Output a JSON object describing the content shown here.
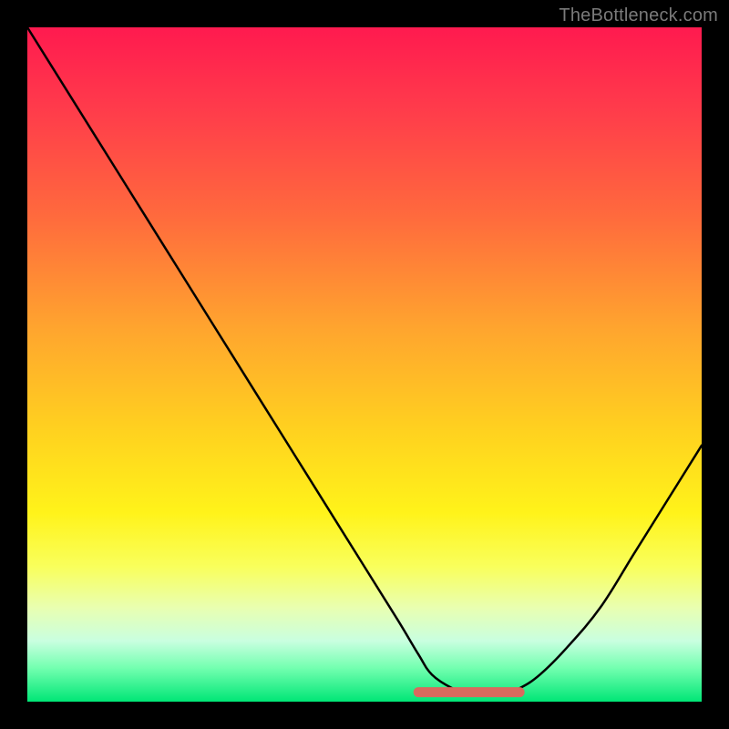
{
  "watermark": "TheBottleneck.com",
  "chart_data": {
    "type": "line",
    "title": "",
    "xlabel": "",
    "ylabel": "",
    "xlim": [
      0,
      100
    ],
    "ylim": [
      0,
      100
    ],
    "grid": false,
    "legend": false,
    "series": [
      {
        "name": "main-curve",
        "color": "#000000",
        "x": [
          0,
          5,
          10,
          15,
          20,
          25,
          30,
          35,
          40,
          45,
          50,
          55,
          58,
          60,
          63,
          66,
          70,
          73,
          76,
          80,
          85,
          90,
          95,
          100
        ],
        "y": [
          100,
          92,
          84,
          76,
          68,
          60,
          52,
          44,
          36,
          28,
          20,
          12,
          7,
          4,
          2,
          1,
          1,
          2,
          4,
          8,
          14,
          22,
          30,
          38
        ]
      },
      {
        "name": "marker-band",
        "color": "#d96a5e",
        "x": [
          58,
          73
        ],
        "y": [
          1,
          1
        ]
      }
    ],
    "gradient_stops": [
      {
        "offset": 0,
        "color": "#ff1a4f"
      },
      {
        "offset": 12,
        "color": "#ff3b4b"
      },
      {
        "offset": 28,
        "color": "#ff6a3d"
      },
      {
        "offset": 45,
        "color": "#ffa62e"
      },
      {
        "offset": 60,
        "color": "#ffd21f"
      },
      {
        "offset": 72,
        "color": "#fff31a"
      },
      {
        "offset": 80,
        "color": "#f9ff5c"
      },
      {
        "offset": 86,
        "color": "#e9ffb0"
      },
      {
        "offset": 91,
        "color": "#c9ffe0"
      },
      {
        "offset": 95,
        "color": "#73ffb0"
      },
      {
        "offset": 100,
        "color": "#00e676"
      }
    ]
  }
}
